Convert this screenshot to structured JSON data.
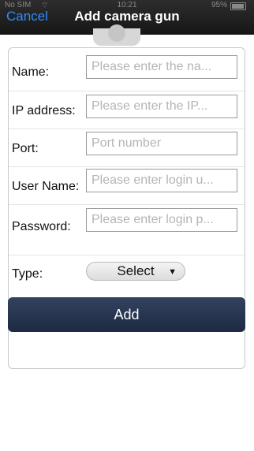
{
  "status_bar": {
    "carrier": "No SIM",
    "time": "10:21",
    "battery": "95%"
  },
  "nav": {
    "cancel_label": "Cancel",
    "title": "Add camera gun"
  },
  "form": {
    "name": {
      "label": "Name:",
      "placeholder": "Please enter the na..."
    },
    "ip": {
      "label": "IP address:",
      "placeholder": "Please enter the IP..."
    },
    "port": {
      "label": "Port:",
      "placeholder": "Port number"
    },
    "user": {
      "label": "User Name:",
      "placeholder": "Please enter login u..."
    },
    "password": {
      "label": "Password:",
      "placeholder": "Please enter login p..."
    },
    "type": {
      "label": "Type:",
      "value": "Select"
    },
    "submit_label": "Add"
  },
  "colors": {
    "nav_background": "#1e1e1e",
    "cancel_text": "#2f8cff",
    "add_button": "#26344f"
  }
}
